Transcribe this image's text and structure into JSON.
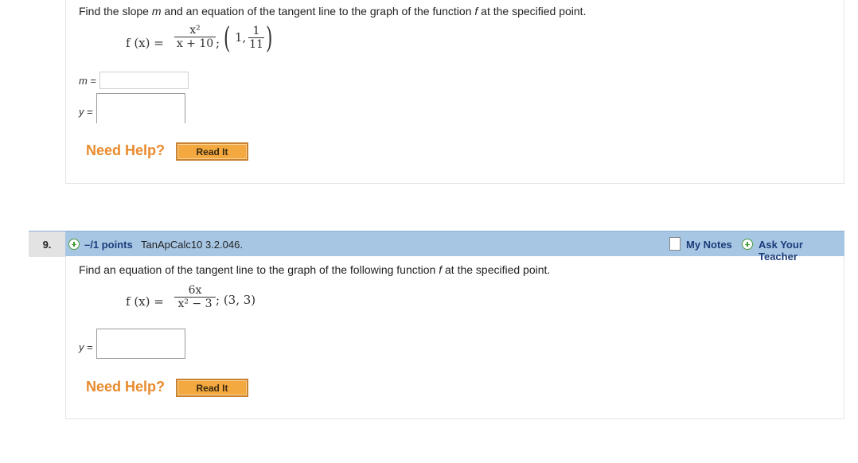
{
  "q8": {
    "prompt_pre": "Find the slope ",
    "prompt_m": "m",
    "prompt_mid": " and an equation of the tangent line to the graph of the function ",
    "prompt_f": "f",
    "prompt_post": " at the specified point.",
    "func_lhs": "f (x) =",
    "func_num": "x²",
    "func_den": "x + 10",
    "func_sep": ";",
    "point_x": "1,",
    "point_num": "1",
    "point_den": "11",
    "m_label_var": "m",
    "m_label_eq": " =",
    "y_label_var": "y",
    "y_label_eq": " =",
    "need_help": "Need Help?",
    "read_it": "Read It"
  },
  "q9": {
    "number": "9.",
    "points": "–/1 points",
    "source": "TanApCalc10 3.2.046.",
    "my_notes": "My Notes",
    "ask_teacher": "Ask Your Teacher",
    "prompt_pre": "Find an equation of the tangent line to the graph of the following function ",
    "prompt_f": "f",
    "prompt_post": " at the specified point.",
    "func_lhs": "f (x) =",
    "func_num": "6x",
    "func_den": "x² − 3",
    "point": "; (3, 3)",
    "y_label_var": "y",
    "y_label_eq": " =",
    "need_help": "Need Help?",
    "read_it": "Read It"
  },
  "colors": {
    "header_bg": "#a7c6e3",
    "link": "#1a3c7a",
    "need_help": "#e98a2c",
    "button": "#f4a940",
    "plus": "#3d9a2e"
  },
  "icons": [
    "plus-circle-icon",
    "notes-icon"
  ]
}
